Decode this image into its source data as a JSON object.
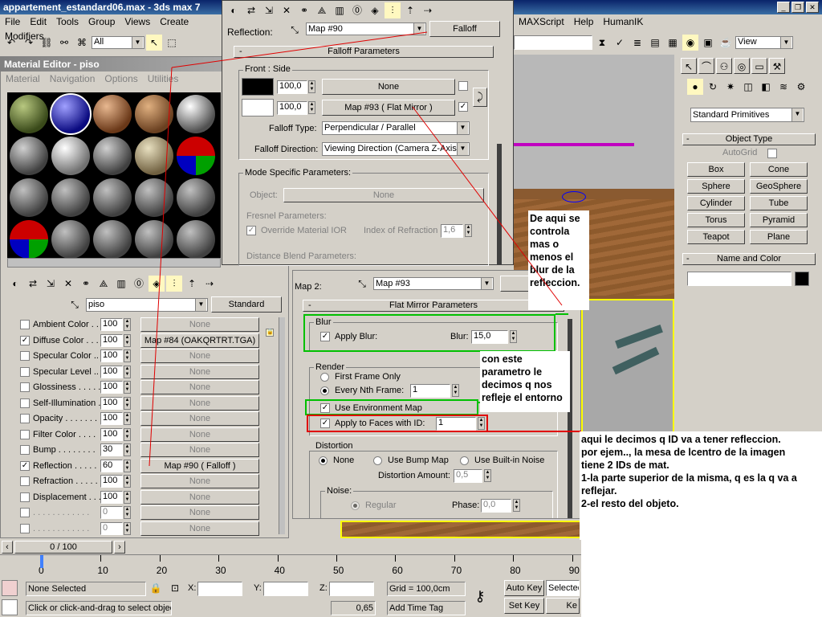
{
  "window": {
    "title": "appartement_estandard06.max - 3ds max 7"
  },
  "menu": {
    "items": [
      "File",
      "Edit",
      "Tools",
      "Group",
      "Views",
      "Create",
      "Modifiers"
    ],
    "right_items": [
      "MAXScript",
      "Help",
      "HumanIK"
    ]
  },
  "toolbar": {
    "selection_filter": "All",
    "view_dropdown": "View"
  },
  "material_editor": {
    "title": "Material Editor - piso",
    "menu": [
      "Material",
      "Navigation",
      "Options",
      "Utilities"
    ],
    "material_name": "piso",
    "type_button": "Standard"
  },
  "maps": {
    "rows": [
      {
        "label": "Ambient Color . . .",
        "amount": "100",
        "map": "None",
        "checked": false
      },
      {
        "label": "Diffuse Color . . .",
        "amount": "100",
        "map": "Map #84 (OAKQRTRT.TGA)",
        "checked": true
      },
      {
        "label": "Specular Color ..",
        "amount": "100",
        "map": "None",
        "checked": false
      },
      {
        "label": "Specular Level ..",
        "amount": "100",
        "map": "None",
        "checked": false
      },
      {
        "label": "Glossiness . . . . .",
        "amount": "100",
        "map": "None",
        "checked": false
      },
      {
        "label": "Self-Illumination .",
        "amount": "100",
        "map": "None",
        "checked": false
      },
      {
        "label": "Opacity . . . . . . .",
        "amount": "100",
        "map": "None",
        "checked": false
      },
      {
        "label": "Filter Color . . . .",
        "amount": "100",
        "map": "None",
        "checked": false
      },
      {
        "label": "Bump . . . . . . . .",
        "amount": "30",
        "map": "None",
        "checked": false
      },
      {
        "label": "Reflection . . . . .",
        "amount": "60",
        "map": "Map #90  ( Falloff )",
        "checked": true
      },
      {
        "label": "Refraction . . . . .",
        "amount": "100",
        "map": "None",
        "checked": false
      },
      {
        "label": "Displacement . . .",
        "amount": "100",
        "map": "None",
        "checked": false
      },
      {
        "label": ". . . . . . . . . . . .",
        "amount": "0",
        "map": "None",
        "checked": false
      },
      {
        "label": ". . . . . . . . . . . .",
        "amount": "0",
        "map": "None",
        "checked": false
      }
    ]
  },
  "falloff": {
    "reflection_label": "Reflection:",
    "map_name": "Map #90",
    "type_button": "Falloff",
    "rollout_title": "Falloff Parameters",
    "front_side_label": "Front : Side",
    "value1": "100,0",
    "slot1": "None",
    "value2": "100,0",
    "slot2": "Map #93  ( Flat Mirror )",
    "falloff_type_label": "Falloff Type:",
    "falloff_type": "Perpendicular / Parallel",
    "falloff_direction_label": "Falloff Direction:",
    "falloff_direction": "Viewing Direction (Camera Z-Axis)",
    "mode_specific": "Mode Specific Parameters:",
    "object_label": "Object:",
    "object_button": "None",
    "fresnel_label": "Fresnel Parameters:",
    "override_ior": "Override Material IOR",
    "ior_label": "Index of Refraction",
    "ior_value": "1,6",
    "distance_blend": "Distance Blend Parameters:"
  },
  "flat_mirror": {
    "map2_label": "Map 2:",
    "map_name": "Map #93",
    "type_button": "Flat",
    "rollout_title": "Flat Mirror Parameters",
    "blur_group": "Blur",
    "apply_blur": "Apply Blur:",
    "blur_label": "Blur:",
    "blur_value": "15,0",
    "render_group": "Render",
    "first_frame": "First Frame Only",
    "every_nth": "Every Nth Frame:",
    "nth_value": "1",
    "use_env_map": "Use Environment Map",
    "apply_faces": "Apply to Faces with ID:",
    "face_id": "1",
    "distortion_group": "Distortion",
    "dist_none": "None",
    "use_bump": "Use Bump Map",
    "use_noise": "Use Built-in Noise",
    "distortion_amount": "Distortion Amount:",
    "distortion_value": "0,5",
    "noise_group": "Noise:",
    "regular": "Regular",
    "phase_label": "Phase:",
    "phase_value": "0,0"
  },
  "command_panel": {
    "category": "Standard Primitives",
    "object_type_title": "Object Type",
    "autogrid": "AutoGrid",
    "buttons": [
      "Box",
      "Cone",
      "Sphere",
      "GeoSphere",
      "Cylinder",
      "Tube",
      "Torus",
      "Pyramid",
      "Teapot",
      "Plane"
    ],
    "name_color_title": "Name and Color",
    "color": "#000000"
  },
  "annotations": {
    "note1": "De aqui se\ncontrola\nmas o\nmenos el\nblur de la\nrefleccion.",
    "note2": "con este\nparametro le\ndecimos q nos\nrefleje el entorno",
    "note3": "aqui le decimos q ID va a tener refleccion.\npor ejem.., la mesa de lcentro de la imagen\ntiene 2  IDs de mat.\n1-la parte superior de la misma, q es la q va a\nreflejar.\n2-el resto del objeto."
  },
  "timeline": {
    "frame": "0 / 100",
    "ticks": [
      "0",
      "10",
      "20",
      "30",
      "40",
      "50",
      "60",
      "70",
      "80",
      "90"
    ]
  },
  "status": {
    "selection": "None Selected",
    "x_label": "X:",
    "y_label": "Y:",
    "z_label": "Z:",
    "grid": "Grid = 100,0cm",
    "prompt": "Click or click-and-drag to select objec",
    "add_time_tag": "Add Time Tag",
    "value": "0,65",
    "auto_key": "Auto Key",
    "set_key": "Set Key",
    "selected": "Selected",
    "key_label": "Ke"
  }
}
